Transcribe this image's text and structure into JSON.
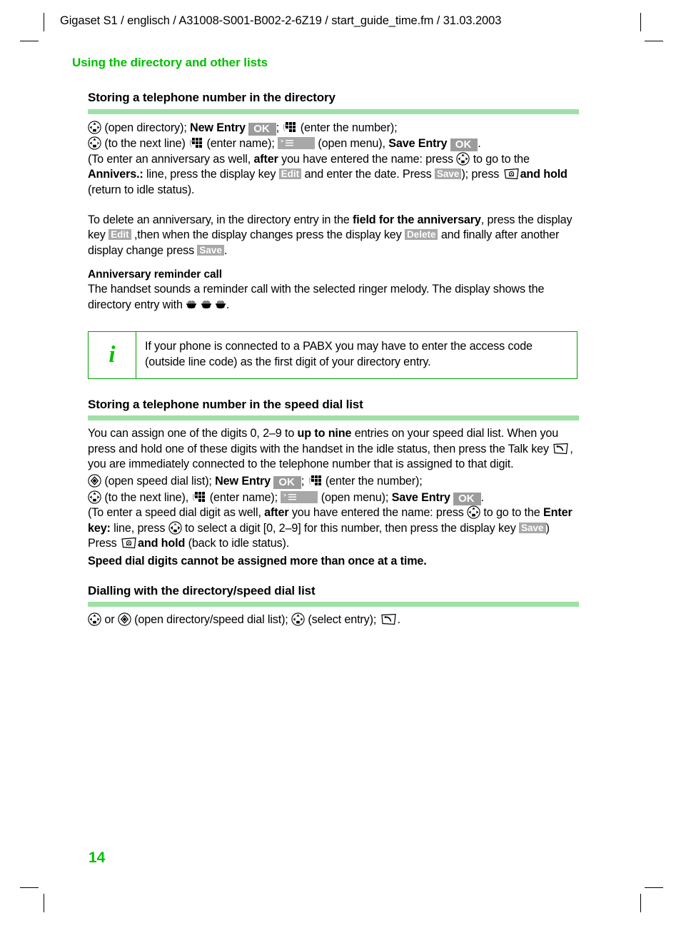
{
  "running_header": "Gigaset S1 / englisch / A31008-S001-B002-2-6Z19 / start_guide_time.fm / 31.03.2003",
  "chapter_title": "Using the directory and other lists",
  "page_number": "14",
  "colors": {
    "accent_green": "#00bf00",
    "rule_green": "#9ee0a5",
    "box_border_green": "#00a000",
    "chip_gray": "#a8a8a8"
  },
  "sections": {
    "directory": {
      "heading": "Storing a telephone number in the directory",
      "line1": {
        "a": "(open directory);",
        "new_entry": "New Entry",
        "ok": "OK",
        "semi": ";",
        "enter_number": "(enter the number);"
      },
      "line2": {
        "to_next_line": "(to the next line)",
        "enter_name": "(enter name);",
        "open_menu": "(open menu),",
        "save_entry": "Save Entry",
        "ok": "OK",
        "period": "."
      },
      "paragraph_anniversary": {
        "t1": "(To enter an anniversary as well, ",
        "after": "after",
        "t2": " you have entered the name: press ",
        "t3": " to go to the ",
        "annivers_label": "Annivers.:",
        "t4": " line, press the display key ",
        "edit": "Edit",
        "t5": " and enter the date. Press ",
        "save": "Save",
        "t6": "); press ",
        "and_hold": "and hold",
        "t7": " (return to idle status)."
      },
      "paragraph_delete": {
        "t1": "To delete an anniversary, in the directory entry in the ",
        "bold": "field for the anniversary",
        "t2": ", press the display key ",
        "edit": "Edit",
        "t3": " ,then when the display changes press the display key ",
        "delete": "Delete",
        "t4": " and finally after another display change press ",
        "save": "Save",
        "t5": "."
      },
      "reminder": {
        "heading": "Anniversary reminder call",
        "t1": "The handset sounds a reminder call with the selected ringer melody. The display shows the directory entry with ",
        "t2": "."
      },
      "infobox": "If your phone is connected to a PABX you may have to enter the access code (outside line code) as the first digit of your directory entry."
    },
    "speed_dial": {
      "heading": "Storing a telephone number in the speed dial list",
      "intro": {
        "t1": "You can assign one of the digits 0, 2–9 to ",
        "bold": "up to nine",
        "t2": " entries on your speed dial list. When you press and hold one of these digits with the handset in the idle status, then press the Talk key ",
        "t3": ", you are immediately connected to the telephone number that is assigned to that digit."
      },
      "line1": {
        "a": "(open speed dial list);",
        "new_entry": "New Entry",
        "ok": "OK",
        "semi": ";",
        "enter_number": "(enter the number);"
      },
      "line2": {
        "to_next_line": "(to the next line),",
        "enter_name": "(enter name);",
        "open_menu": "(open menu);",
        "save_entry": "Save Entry",
        "ok": "OK",
        "period": "."
      },
      "paragraph_digit": {
        "t1": "(To enter a speed dial digit as well, ",
        "after": "after",
        "t2": " you have entered the name: press ",
        "t3": " to go to the ",
        "enter_key_label": "Enter key:",
        "t4": " line, press ",
        "t5": " to select a digit [0, 2–9] for this number, then press the display key ",
        "save": "Save",
        "t6": ") Press ",
        "and_hold": "and hold",
        "t7": " (back to idle status)."
      },
      "warning": "Speed dial digits cannot be assigned more than once at a time."
    },
    "dialling": {
      "heading": "Dialling with the directory/speed dial list",
      "line": {
        "or": "or",
        "open_lists": "(open directory/speed dial list);",
        "select_entry": "(select entry);",
        "period": "."
      }
    }
  },
  "icons": {
    "nav_key": "navigation-key",
    "nav_key_down": "navigation-key-down",
    "nav_key_updown": "navigation-key-up-down",
    "nav_key_leftright": "navigation-key-left-right",
    "speed_dial_key": "speed-dial-key",
    "keypad": "keypad-with-hand",
    "talk_key": "talk-key",
    "end_call_key": "end-call-key",
    "menu_key": "menu-key",
    "cake": "birthday-cake"
  }
}
